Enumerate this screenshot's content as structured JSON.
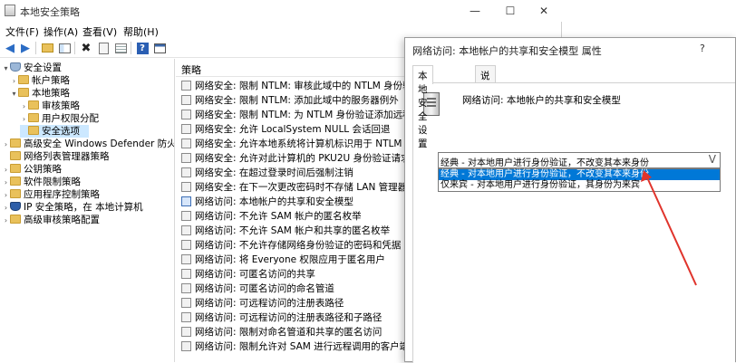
{
  "main_window": {
    "title": "本地安全策略",
    "controls": {
      "minimize": "—",
      "maximize": "☐",
      "close": "✕"
    }
  },
  "menu": [
    "文件(F)",
    "操作(A)",
    "查看(V)",
    "帮助(H)"
  ],
  "toolbar": {
    "icons": [
      "back-icon",
      "forward-icon",
      "up-folder-icon",
      "show-tree-icon",
      "delete-icon",
      "properties-icon",
      "export-list-icon",
      "help-icon",
      "console-icon"
    ]
  },
  "tree": {
    "root": "安全设置",
    "items": [
      "帐户策略",
      "本地策略",
      "审核策略",
      "用户权限分配",
      "安全选项",
      "高级安全 Windows Defender 防火墙",
      "网络列表管理器策略",
      "公钥策略",
      "软件限制策略",
      "应用程序控制策略",
      "IP 安全策略，在 本地计算机",
      "高级审核策略配置"
    ]
  },
  "policy_list": {
    "header": "策略",
    "rows": [
      "网络安全: 限制 NTLM: 审核此域中的 NTLM 身份验证",
      "网络安全: 限制 NTLM: 添加此域中的服务器例外",
      "网络安全: 限制 NTLM: 为 NTLM 身份验证添加远程服务器",
      "网络安全: 允许 LocalSystem NULL 会话回退",
      "网络安全: 允许本地系统将计算机标识用于 NTLM",
      "网络安全: 允许对此计算机的 PKU2U 身份验证请求使用联",
      "网络安全: 在超过登录时间后强制注销",
      "网络安全: 在下一次更改密码时不存储 LAN 管理器哈希值",
      "网络访问: 本地帐户的共享和安全模型",
      "网络访问: 不允许 SAM 帐户的匿名枚举",
      "网络访问: 不允许 SAM 帐户和共享的匿名枚举",
      "网络访问: 不允许存储网络身份验证的密码和凭据",
      "网络访问: 将 Everyone 权限应用于匿名用户",
      "网络访问: 可匿名访问的共享",
      "网络访问: 可匿名访问的命名管道",
      "网络访问: 可远程访问的注册表路径",
      "网络访问: 可远程访问的注册表路径和子路径",
      "网络访问: 限制对命名管道和共享的匿名访问",
      "网络访问: 限制允许对 SAM 进行远程调用的客户端"
    ],
    "selected_index": 8
  },
  "dialog": {
    "title": "网络访问: 本地帐户的共享和安全模型 属性",
    "help": "?",
    "tabs": [
      "本地安全设置",
      "说明"
    ],
    "policy_name": "网络访问: 本地帐户的共享和安全模型",
    "combo_value": "经典 - 对本地用户进行身份验证，不改变其本来身份",
    "combo_chevron": "V",
    "options": [
      "经典 - 对本地用户进行身份验证，不改变其本来身份",
      "仅来宾 - 对本地用户进行身份验证，其身份为来宾"
    ],
    "highlighted_option": 0
  },
  "annotation": {
    "arrow_color": "#e0342c"
  }
}
